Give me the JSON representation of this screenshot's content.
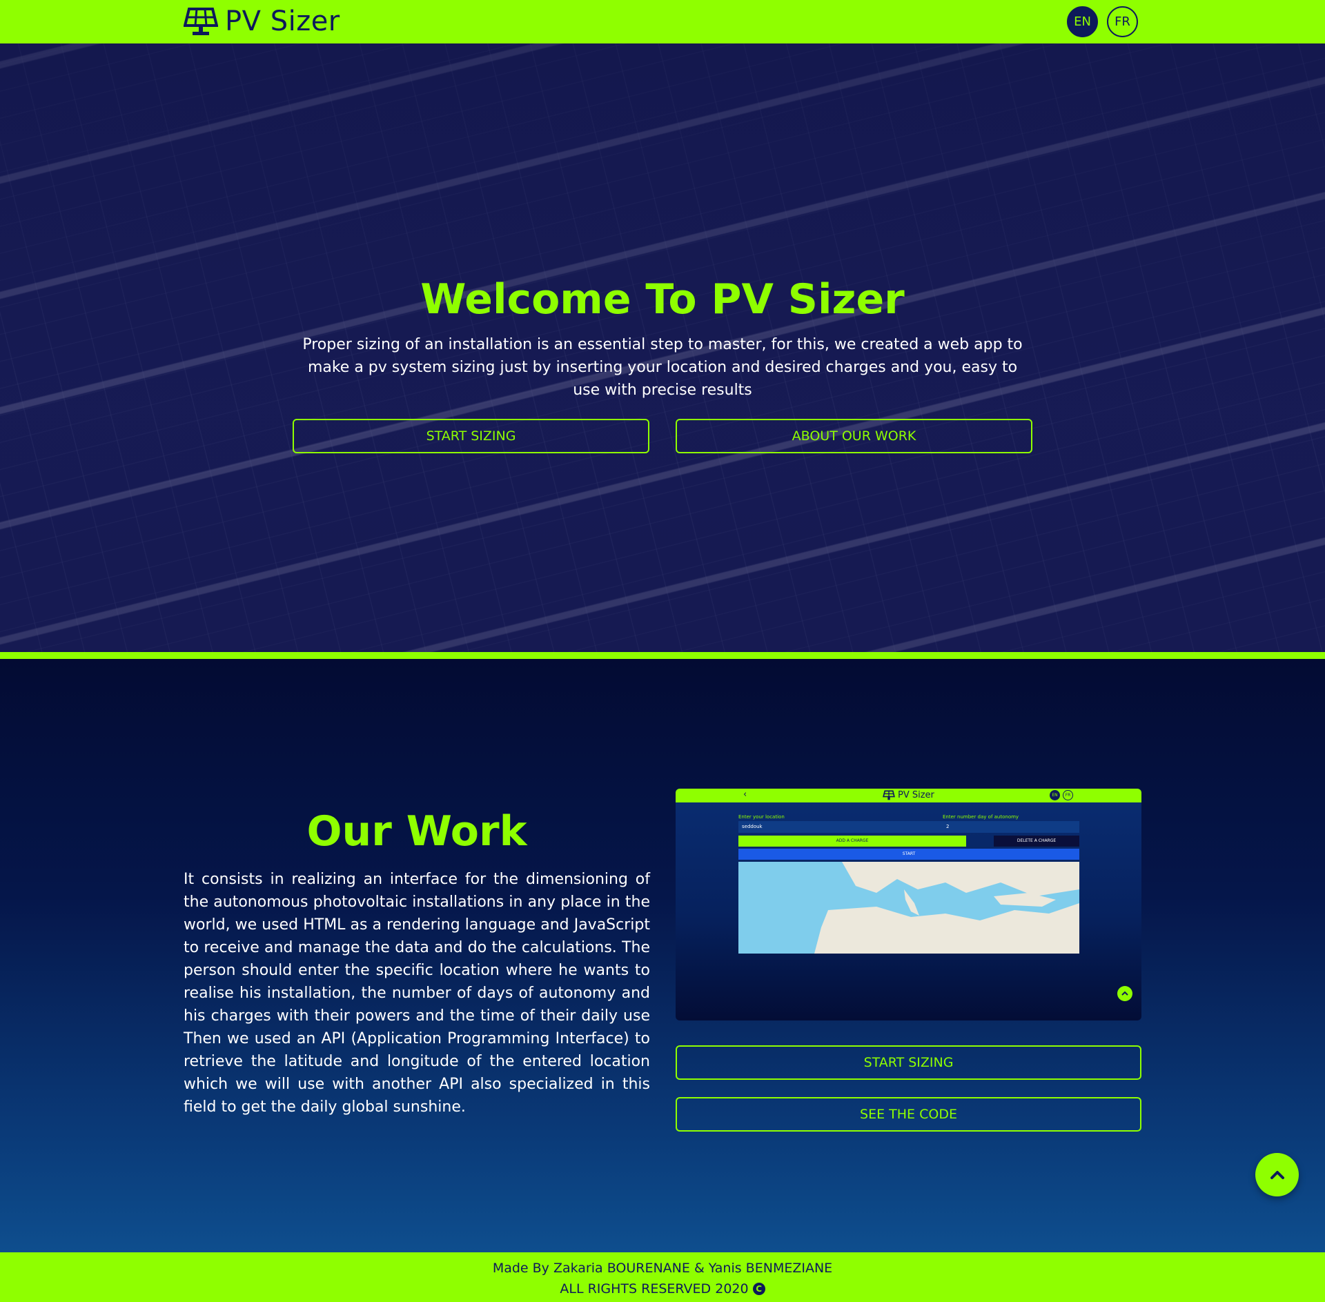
{
  "navbar": {
    "brand": "PV Sizer",
    "brand_icon": "solar-panel-icon",
    "languages": [
      {
        "code": "EN",
        "active": true
      },
      {
        "code": "FR",
        "active": false
      }
    ]
  },
  "hero": {
    "title": "Welcome To PV Sizer",
    "description": "Proper sizing of an installation is an essential step to master, for this, we created a web app to make a pv system sizing just by inserting your location and desired charges and you, easy to use with precise results",
    "buttons": [
      "START SIZING",
      "ABOUT OUR WORK"
    ]
  },
  "work": {
    "title": "Our Work",
    "text": "It consists in realizing an interface for the dimensioning of the autonomous photovoltaic installations in any place in the world, we used HTML as a rendering language and JavaScript to receive and manage the data and do the calculations. The person should enter the specific location where he wants to realise his installation, the number of days of autonomy and his charges with their powers and the time of their daily use Then we used an API (Application Programming Interface) to retrieve the latitude and longitude of the entered location which we will use with another API also specialized in this field to get the daily global sunshine.",
    "buttons": [
      "START SIZING",
      "SEE THE CODE"
    ],
    "preview": {
      "brand": "PV Sizer",
      "lang_en": "EN",
      "lang_fr": "FR",
      "location_label": "Enter your location",
      "location_value": "seddouk",
      "autonomy_label": "Enter number day of autonomy",
      "autonomy_value": "2",
      "add_charge": "ADD A CHARGE",
      "delete_charge": "DELETE A CHARGE",
      "start": "START"
    }
  },
  "footer": {
    "credits": "Made By Zakaria BOURENANE & Yanis BENMEZIANE",
    "rights": "ALL RIGHTS RESERVED 2020"
  },
  "colors": {
    "accent": "#8fff00",
    "navy": "#0d1a5a"
  }
}
